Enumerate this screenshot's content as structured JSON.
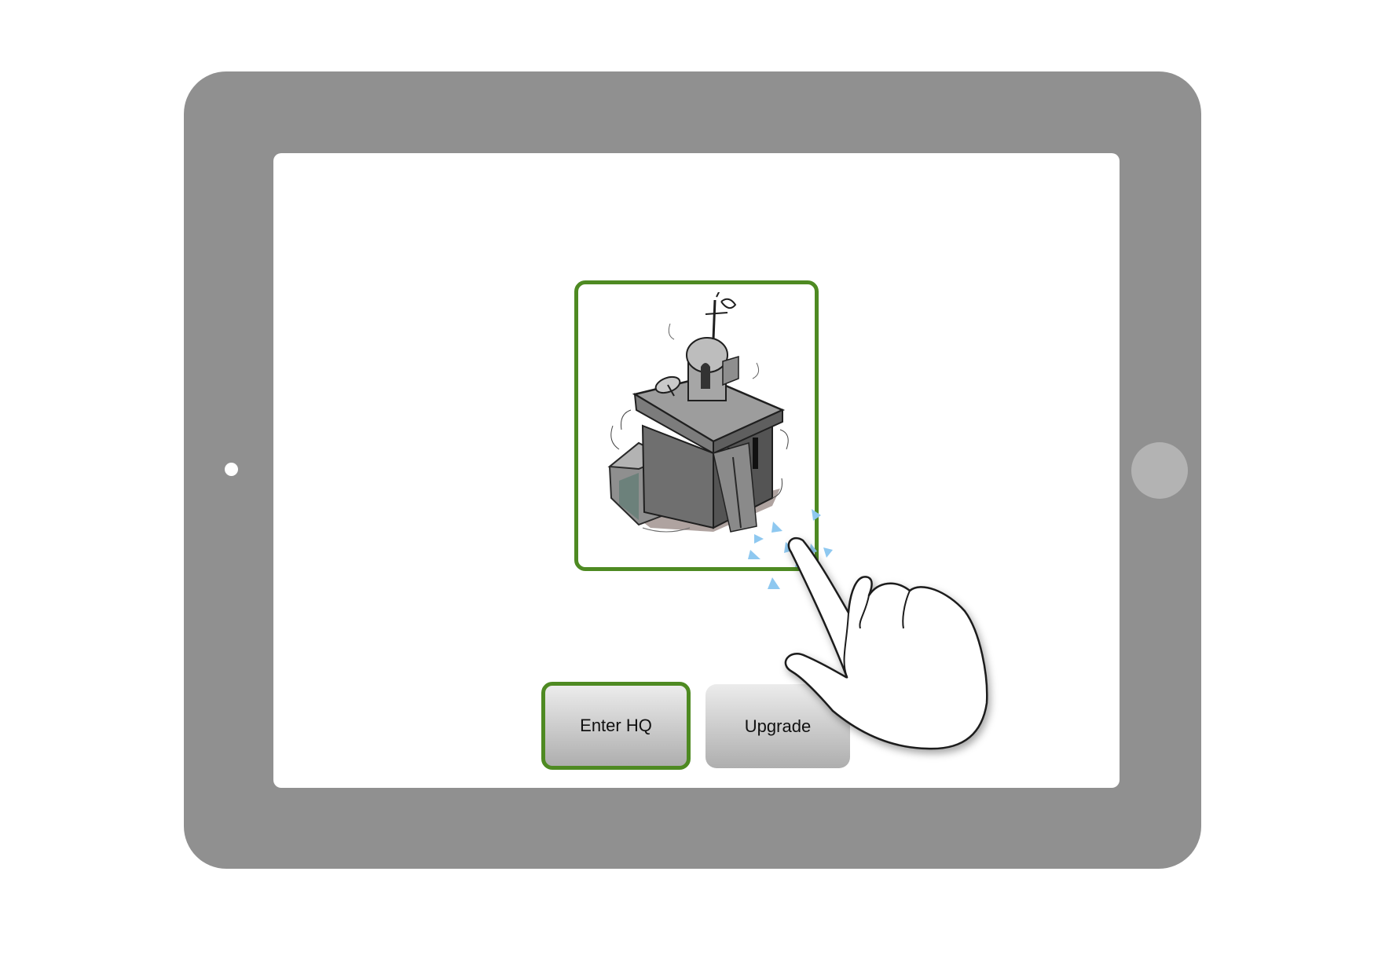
{
  "device": {
    "type": "tablet",
    "frame_color": "#909090",
    "screen_color": "#ffffff",
    "icons": {
      "camera": "camera-icon",
      "home": "home-button-icon"
    }
  },
  "selected_building": {
    "icon": "hq-building-icon",
    "selected": true,
    "highlight_color": "#4e8a22"
  },
  "actions": {
    "enter_hq": {
      "label": "Enter HQ",
      "highlighted": true
    },
    "upgrade": {
      "label": "Upgrade",
      "highlighted": false
    }
  },
  "gesture": {
    "type": "tap",
    "icon": "tap-hand-icon",
    "ripple_color": "#8ec8f0"
  }
}
